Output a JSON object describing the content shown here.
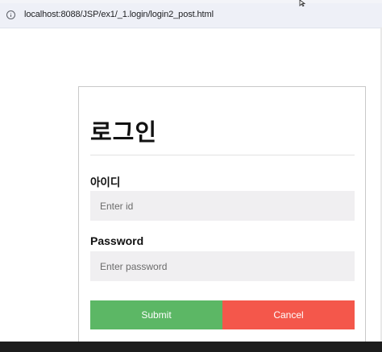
{
  "browser": {
    "url": "localhost:8088/JSP/ex1/_1.login/login2_post.html",
    "icons": {
      "site_info": "info-icon",
      "cursor": "cursor-icon"
    }
  },
  "form": {
    "title": "로그인",
    "id_label": "아이디",
    "id_placeholder": "Enter id",
    "password_label": "Password",
    "password_placeholder": "Enter password",
    "submit_label": "Submit",
    "cancel_label": "Cancel"
  },
  "colors": {
    "submit": "#5cb765",
    "cancel": "#f4574b",
    "input_background": "#f0eff1"
  }
}
